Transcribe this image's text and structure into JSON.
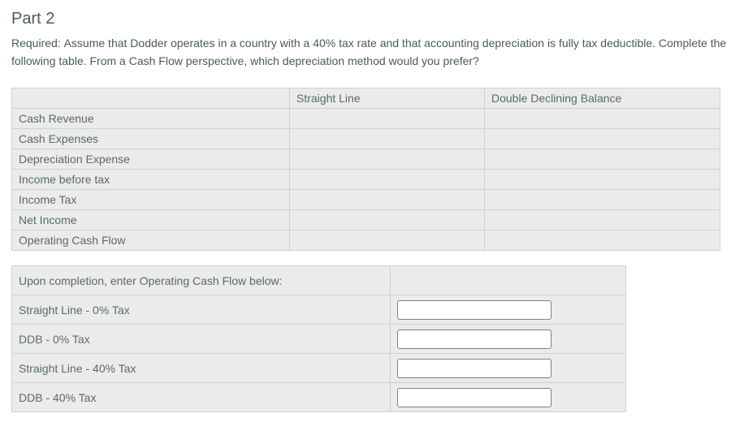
{
  "heading": "Part 2",
  "required_text": "Required: Assume that Dodder operates in a country with a 40% tax rate and that accounting depreciation is fully tax deductible. Complete the following table. From a Cash Flow perspective, which depreciation method would you prefer?",
  "main_table": {
    "headers": [
      "",
      "Straight Line",
      "Double Declining Balance"
    ],
    "rows": [
      "Cash Revenue",
      "Cash Expenses",
      "Depreciation Expense",
      "Income before tax",
      "Income Tax",
      "Net Income",
      "Operating Cash Flow"
    ]
  },
  "entry_table": {
    "header": "Upon completion, enter Operating Cash Flow below:",
    "rows": [
      "Straight Line - 0% Tax",
      "DDB - 0% Tax",
      "Straight Line - 40% Tax",
      "DDB - 40% Tax"
    ],
    "values": [
      "",
      "",
      "",
      ""
    ]
  }
}
